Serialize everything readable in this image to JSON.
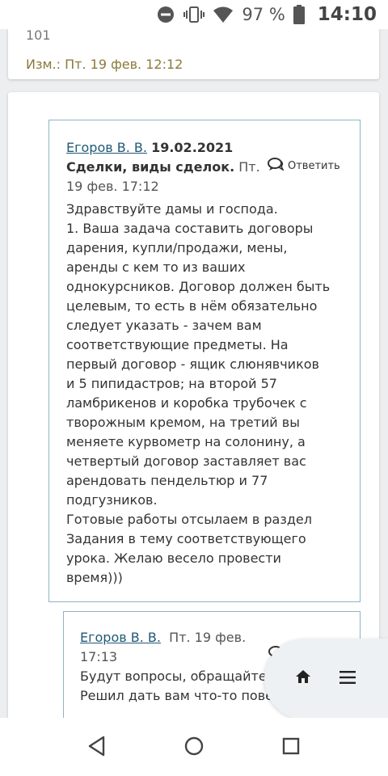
{
  "status": {
    "battery": "97 %",
    "time": "14:10"
  },
  "card_prev": {
    "partial_text": "101",
    "edited": "Изм.: Пт. 19 фев. 12:12"
  },
  "post1": {
    "author": "Егоров В. В.",
    "date": "19.02.2021",
    "subject": "Сделки, виды сделок.",
    "time": "Пт. 19 фев. 17:12",
    "reply_label": "Ответить",
    "body": [
      "Здравствуйте дамы и господа.",
      "1. Ваша задача составить договоры",
      "дарения, купли/продажи, мены,",
      "аренды с кем то из ваших",
      "однокурсников. Договор должен быть",
      "целевым, то есть в нём обязательно",
      "следует указать - зачем вам",
      "соответствующие предметы. На",
      "первый договор - ящик слюнявчиков",
      "и 5 пипидастров; на второй 57",
      "ламбрикенов и коробка трубочек с",
      "творожным кремом, на третий вы",
      "меняете курвометр на солонину, а",
      "четвертый договор заставляет вас",
      "арендовать пендельтюр и 77",
      "подгузников.",
      "Готовые работы отсылаем в раздел",
      "Задания в тему соответствующего",
      "урока. Желаю весело провести",
      "время)))"
    ]
  },
  "post2": {
    "author": "Егоров В. В.",
    "time_line1": "Пт. 19 фев.",
    "time_line2": "17:13",
    "body": [
      "Будут вопросы, обращайтесь.",
      "Решил дать вам что-то поведения"
    ]
  },
  "icons": {
    "status": [
      "dnd-icon",
      "vibrate-icon",
      "wifi-icon",
      "battery-icon"
    ],
    "reply": "speech-bubble-icon",
    "fab": [
      "home-icon",
      "menu-icon"
    ],
    "nav": [
      "back-icon",
      "home-circle-icon",
      "recents-icon"
    ]
  }
}
